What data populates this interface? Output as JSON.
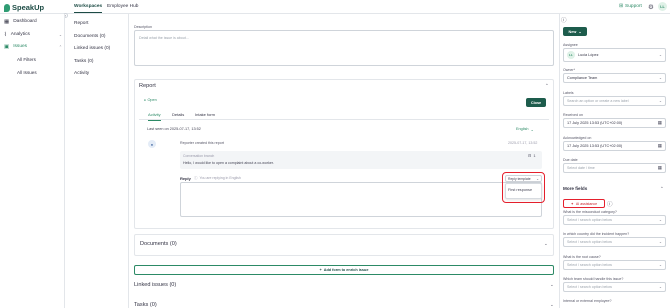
{
  "app": {
    "logo_text": "SpeakUp"
  },
  "topnav": {
    "tabs": [
      "Workspaces",
      "Employee Hub"
    ],
    "support_label": "Support",
    "avatar_initials": "LL"
  },
  "sidebar": {
    "items": [
      {
        "label": "Dashboard",
        "icon": "grid-icon"
      },
      {
        "label": "Analytics",
        "icon": "chart-icon"
      },
      {
        "label": "Issues",
        "icon": "issues-icon"
      }
    ],
    "sub_items": [
      "All Filters",
      "All Issues"
    ]
  },
  "subnav": {
    "items": [
      "Report",
      "Documents (0)",
      "Linked issues (0)",
      "Tasks (0)",
      "Activity"
    ]
  },
  "description": {
    "label": "Description",
    "placeholder": "Detail what the issue is about..."
  },
  "report": {
    "title": "Report",
    "status": "Open",
    "close_label": "Close",
    "tabs": [
      "Activity",
      "Details",
      "Intake form"
    ],
    "last_seen": "Last seen on 2025-07-17, 13:52",
    "language": "English",
    "event": {
      "text": "Reporter created this report",
      "timestamp": "2025-07-17, 13:52"
    },
    "message": {
      "label": "Conversation branch",
      "text": "Hello, I would like to open a complaint about a co-worker.",
      "count": "1"
    },
    "reply": {
      "label": "Reply",
      "hint": "You are replying in English",
      "template_label": "Reply template"
    },
    "template_menu": [
      "First response"
    ]
  },
  "documents": {
    "title": "Documents (0)"
  },
  "add_form": {
    "label": "Add form to enrich issue"
  },
  "linked": {
    "title": "Linked issues (0)"
  },
  "tasks": {
    "title": "Tasks (0)"
  },
  "right": {
    "new_label": "New",
    "assignee": {
      "label": "Assignee",
      "initials": "LL",
      "name": "Lucia López"
    },
    "owner": {
      "label": "Owner*",
      "value": "Compliance Team"
    },
    "labels": {
      "label": "Labels",
      "placeholder": "Search an option or create a new label"
    },
    "received": {
      "label": "Received on",
      "value": "17 July 2025 13:53 (UTC+02:00)"
    },
    "acknowledged": {
      "label": "Acknowledged on",
      "value": "17 July 2025 13:53 (UTC+02:00)"
    },
    "due": {
      "label": "Due date",
      "placeholder": "Select date / time"
    },
    "more_fields": "More fields",
    "ai_label": "AI assistance",
    "fields": [
      {
        "label": "What is the misconduct category?",
        "placeholder": "Select / search option below"
      },
      {
        "label": "In which country did the incident happen?",
        "placeholder": "Select / search option below"
      },
      {
        "label": "What is the root cause?",
        "placeholder": "Select / search option below"
      },
      {
        "label": "Which team should handle this issue?",
        "placeholder": "Select / search option below"
      },
      {
        "label": "Internal or external employee?",
        "placeholder": ""
      }
    ]
  },
  "colors": {
    "brand": "#1d5c4c",
    "accent": "#2c8a66",
    "highlight": "#e5202d"
  }
}
